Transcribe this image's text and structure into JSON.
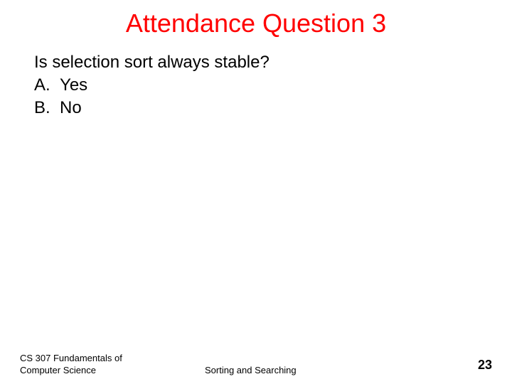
{
  "title": "Attendance Question 3",
  "question": "Is selection sort always stable?",
  "options": [
    {
      "label": "A.",
      "text": "Yes"
    },
    {
      "label": "B.",
      "text": "No"
    }
  ],
  "footer": {
    "course_line1": "CS 307 Fundamentals of",
    "course_line2": "Computer Science",
    "topic": "Sorting and Searching",
    "page_number": "23"
  }
}
